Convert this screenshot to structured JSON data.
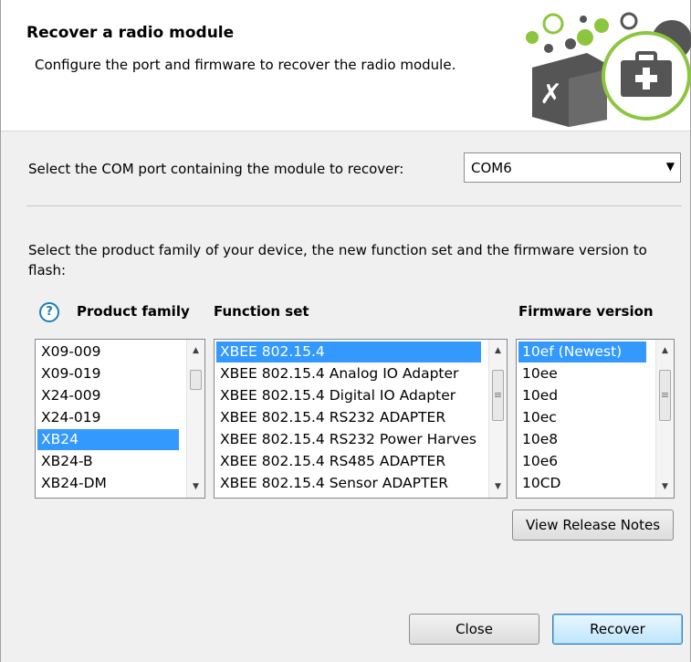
{
  "header": {
    "title": "Recover a radio module",
    "description": "Configure the port and firmware to recover the radio module."
  },
  "port": {
    "label": "Select the COM port containing the module to recover:",
    "value": "COM6"
  },
  "product_instructions": "Select the product family of your device, the new function set and the firmware version to flash:",
  "columns": {
    "product_family": "Product family",
    "function_set": "Function set",
    "firmware_version": "Firmware version"
  },
  "product_family": {
    "items": [
      "X09-009",
      "X09-019",
      "X24-009",
      "X24-019",
      "XB24",
      "XB24-B",
      "XB24-DM"
    ],
    "selected": "XB24"
  },
  "function_set": {
    "items": [
      "XBEE 802.15.4",
      "XBEE 802.15.4 Analog IO Adapter",
      "XBEE 802.15.4 Digital IO Adapter",
      "XBEE 802.15.4 RS232 ADAPTER",
      "XBEE 802.15.4 RS232 Power Harves",
      "XBEE 802.15.4 RS485 ADAPTER",
      "XBEE 802.15.4 Sensor ADAPTER"
    ],
    "selected": "XBEE 802.15.4"
  },
  "firmware_version": {
    "items": [
      "10ef (Newest)",
      "10ee",
      "10ed",
      "10ec",
      "10e8",
      "10e6",
      "10CD"
    ],
    "selected": "10ef (Newest)"
  },
  "buttons": {
    "view_release_notes": "View Release Notes",
    "close": "Close",
    "recover": "Recover"
  },
  "colors": {
    "selection": "#3399ff",
    "accent_green": "#8cc63f",
    "logo_gray": "#555555"
  },
  "icons": [
    "help-icon",
    "dropdown-arrow-icon",
    "scroll-up-icon",
    "scroll-down-icon",
    "tools-box-icon",
    "medical-kit-icon"
  ]
}
